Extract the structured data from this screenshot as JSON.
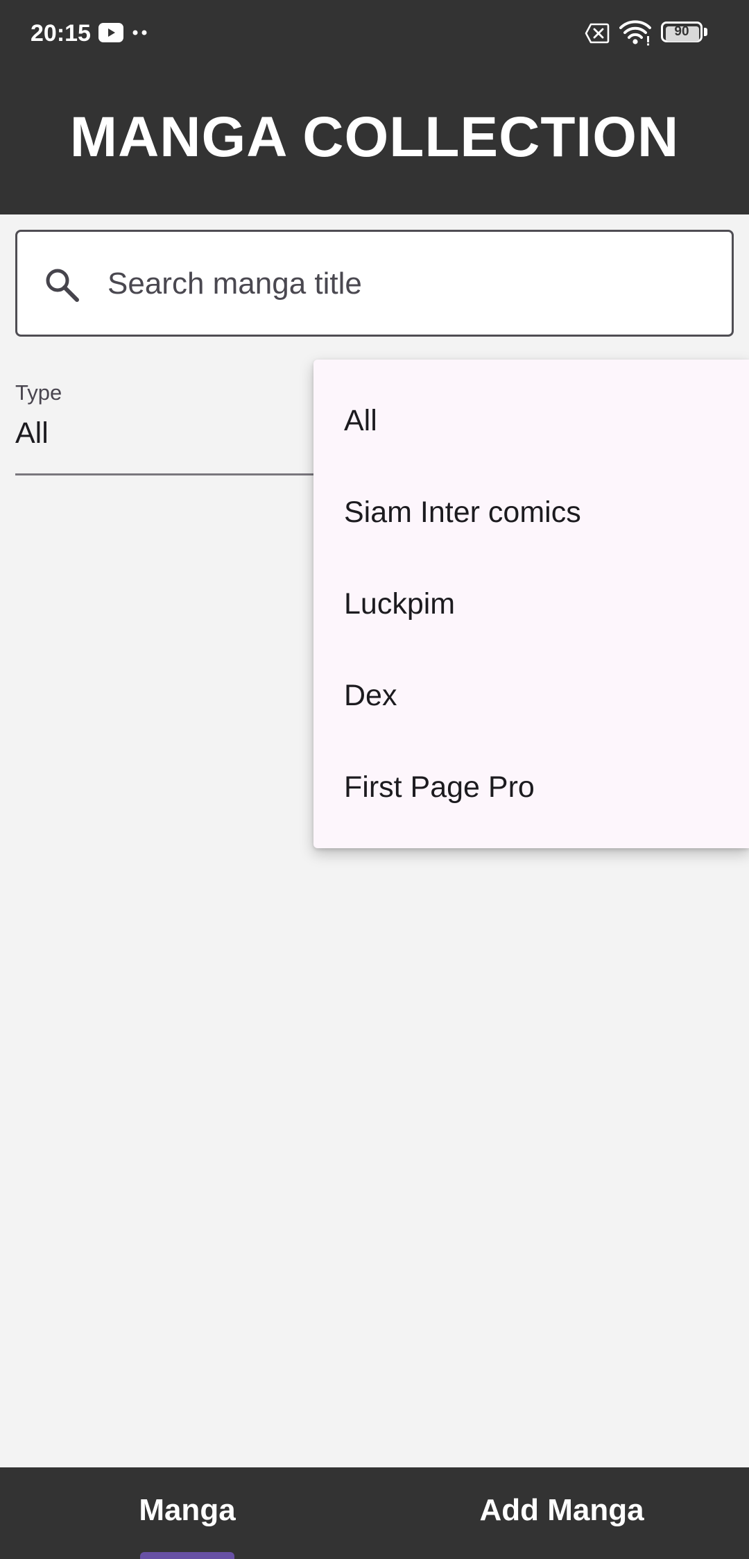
{
  "status_bar": {
    "time": "20:15",
    "battery_level": "90",
    "icons": [
      "youtube-icon",
      "more-dots-icon",
      "no-sim-icon",
      "wifi-icon",
      "battery-icon"
    ]
  },
  "app_bar": {
    "title": "MANGA COLLECTION"
  },
  "search": {
    "value": "",
    "placeholder": "Search manga title",
    "icon": "search-icon"
  },
  "type_filter": {
    "label": "Type",
    "selected": "All"
  },
  "dropdown": {
    "items": [
      {
        "label": "All"
      },
      {
        "label": "Siam Inter comics"
      },
      {
        "label": "Luckpim"
      },
      {
        "label": "Dex"
      },
      {
        "label": "First Page Pro"
      }
    ]
  },
  "bottom_tabs": {
    "items": [
      {
        "label": "Manga",
        "selected": true
      },
      {
        "label": "Add Manga",
        "selected": false
      }
    ]
  },
  "colors": {
    "app_bar": "#333333",
    "background": "#f3f3f3",
    "menu_background": "#fdf6fc",
    "tab_indicator": "#6750a4"
  }
}
